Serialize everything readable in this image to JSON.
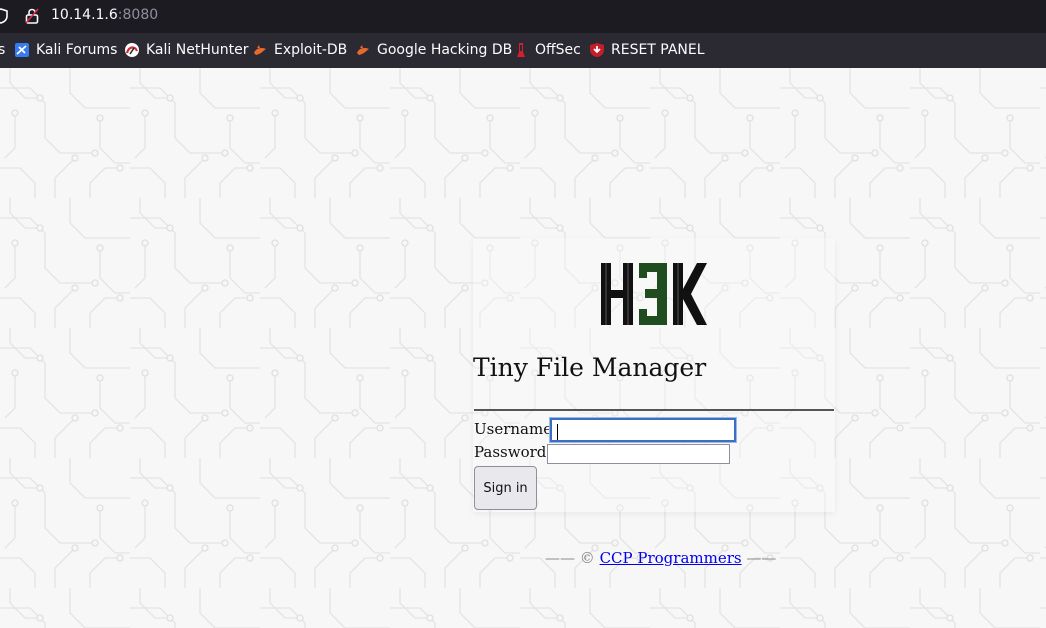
{
  "browser": {
    "url_host": "10.14.1.6",
    "url_port": ":8080",
    "bookmarks": [
      {
        "label": "Kali Forums",
        "icon": "kali-forums-icon"
      },
      {
        "label": "Kali NetHunter",
        "icon": "kali-nethunter-icon"
      },
      {
        "label": "Exploit-DB",
        "icon": "exploit-db-icon"
      },
      {
        "label": "Google Hacking DB",
        "icon": "ghdb-icon"
      },
      {
        "label": "OffSec",
        "icon": "offsec-icon"
      },
      {
        "label": "RESET PANEL",
        "icon": "reset-panel-icon"
      }
    ],
    "bookmark_cut": "s"
  },
  "login": {
    "logo_text": "H3K",
    "title": "Tiny File Manager",
    "username_label": "Username",
    "username_value": "",
    "password_label": "Password",
    "password_value": "",
    "signin_label": "Sign in"
  },
  "footer": {
    "prefix": "—— ©",
    "link_label": "CCP Programmers",
    "suffix": "——"
  },
  "colors": {
    "logo_dark": "#111111",
    "logo_accent": "#1f4d1f",
    "link": "#0000ee",
    "focus": "#3b6fc3"
  }
}
